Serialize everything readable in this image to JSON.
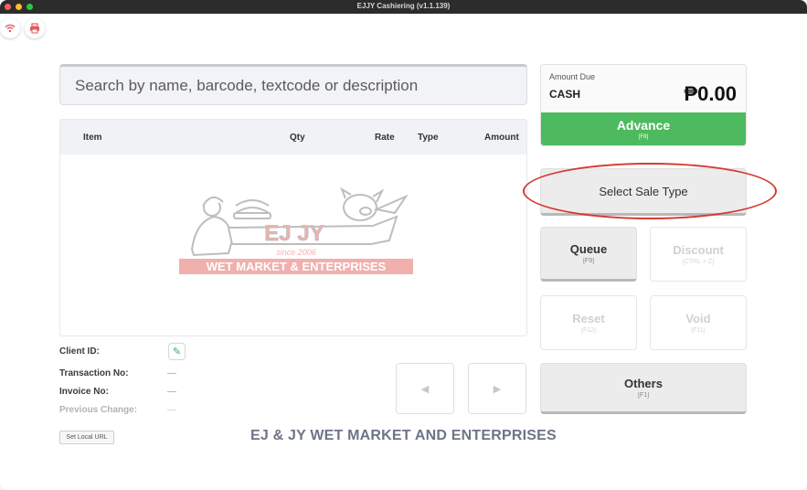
{
  "window": {
    "title": "EJJY Cashiering (v1.1.139)"
  },
  "search": {
    "placeholder": "Search by name, barcode, textcode or description"
  },
  "table": {
    "columns": [
      "Item",
      "Qty",
      "Rate",
      "Type",
      "Amount"
    ],
    "rows": []
  },
  "logo": {
    "name": "EJ JY",
    "since": "since 2006",
    "banner": "WET MARKET & ENTERPRISES"
  },
  "info": {
    "client_id_label": "Client ID:",
    "transaction_no_label": "Transaction No:",
    "transaction_no_value": "—",
    "invoice_no_label": "Invoice No:",
    "invoice_no_value": "—",
    "previous_change_label": "Previous Change:",
    "previous_change_value": "—"
  },
  "set_local_url_label": "Set Local URL",
  "footer_text": "EJ & JY WET MARKET AND ENTERPRISES",
  "amount_due": {
    "label": "Amount Due",
    "payment_type": "CASH",
    "amount": "₱0.00"
  },
  "buttons": {
    "advance": {
      "label": "Advance",
      "key": "[F8]"
    },
    "select_sale_type": {
      "label": "Select Sale Type"
    },
    "queue": {
      "label": "Queue",
      "key": "[F9]"
    },
    "discount": {
      "label": "Discount",
      "key": "[CTRL + Z]"
    },
    "reset": {
      "label": "Reset",
      "key": "[F12]"
    },
    "void": {
      "label": "Void",
      "key": "[F11]"
    },
    "others": {
      "label": "Others",
      "key": "[F1]"
    }
  },
  "icons": {
    "wifi": "wifi-icon",
    "printer": "printer-icon",
    "edit": "pencil-icon",
    "prev": "chevron-left-icon",
    "next": "chevron-right-icon"
  },
  "colors": {
    "accent_green": "#4eba5f",
    "highlight_red": "#d43a2f",
    "logo_red": "#d8322a"
  }
}
